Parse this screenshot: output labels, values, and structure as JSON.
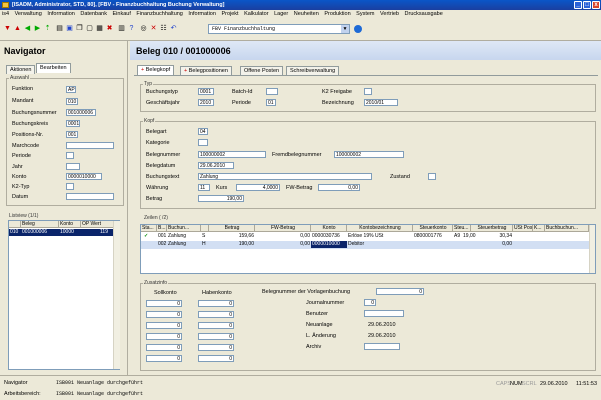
{
  "window": {
    "title": "[ISADM, Administrator, STD, 80], [FBV - Finanzbuchhaltung Buchung Verwaltung]",
    "min": "_",
    "max": "□",
    "close": "x"
  },
  "menu": [
    "is4",
    "Verwaltung",
    "Information",
    "Datenbank",
    "Einkauf",
    "Finanzbuchhaltung",
    "Information",
    "Projekt",
    "Kalkulator",
    "Lager",
    "Neuheiten",
    "Produktion",
    "System",
    "Vertrieb",
    "Drucksausgabe"
  ],
  "toolbar": {
    "icons": [
      "arrow-down-icon",
      "arrow-up-icon",
      "arrow-left-icon",
      "arrow-right-icon",
      "first-icon",
      "document-icon",
      "save-icon",
      "copy-icon",
      "new-icon",
      "attach-icon",
      "delete-icon",
      "print-icon",
      "help-icon",
      "search-icon",
      "clear-icon",
      "tree-icon",
      "undo-icon"
    ],
    "module_select": "FBV  Finanzbuchhaltung"
  },
  "navigator": {
    "title": "Navigator",
    "tabs": [
      "Aktionen",
      "Bearbeiten"
    ],
    "group_label": "Auswahl",
    "fields": [
      {
        "label": "Funktion",
        "value": "AP"
      },
      {
        "label": "Mandant",
        "value": "010"
      },
      {
        "label": "Buchungsnummer",
        "value": "001000006"
      },
      {
        "label": "Buchungskreis",
        "value": "0001"
      },
      {
        "label": "Positions-Nr.",
        "value": "001"
      },
      {
        "label": "Marchcode",
        "value": ""
      },
      {
        "label": "Periode",
        "value": ""
      },
      {
        "label": "Jahr",
        "value": ""
      },
      {
        "label": "Konto",
        "value": "0000010000"
      },
      {
        "label": "K2-Typ",
        "value": ""
      },
      {
        "label": "Datum",
        "value": ""
      }
    ],
    "list_label": "Listview (1/1)",
    "list_headers": [
      "",
      "Beleg",
      "Konto",
      "OP Wert"
    ],
    "list_rows": [
      [
        "010",
        "001000006",
        "10000",
        "119"
      ]
    ]
  },
  "main": {
    "title": "Beleg 010 / 001000006",
    "tabs": [
      "Belegkopf",
      "Belegpositionen",
      "Offene Posten",
      "Schreibverwaltung"
    ],
    "typ": {
      "label": "Typ",
      "buchungstyp_label": "Buchungstyp",
      "buchungstyp": "0001",
      "batch_label": "Batch-Id",
      "batch": "",
      "k2_label": "K2 Freigabe",
      "k2": "",
      "gj_label": "Geschäftsjahr",
      "gj": "2010",
      "periode_label": "Periode",
      "periode": "01",
      "bez_label": "Bezeichnung",
      "bez": "2010/01"
    },
    "kopf": {
      "label": "Kopf",
      "belegart_label": "Belegart",
      "belegart": "04",
      "kategorie_label": "Kategorie",
      "kategorie": "",
      "belegnummer_label": "Belegnummer",
      "belegnummer": "100000002",
      "fremd_label": "Fremdbelegnummer",
      "fremd": "100000002",
      "belegdatum_label": "Belegdatum",
      "belegdatum": "29.06.2010",
      "buchungstext_label": "Buchungstext",
      "buchungstext": "Zahlung",
      "zustand_label": "Zustand",
      "zustand": "",
      "waehrung_label": "Währung",
      "waehrung": "11",
      "kurs_label": "Kurs",
      "kurs": "4,0000",
      "fw_label": "FW-Betrag",
      "fw": "0,00",
      "betrag_label": "Betrag",
      "betrag": "190,00"
    },
    "zeilen": {
      "label": "Zeilen ( /2)",
      "headers": [
        "Sta...",
        "B...",
        "Buchun...",
        "",
        "Betrag",
        "FW-Betrag",
        "Konto",
        "Kontobezeichnung",
        "Steuerkonto",
        "Steu...",
        "Steuerbetrag",
        "USt Pos",
        "K...",
        "Buchbuchun..."
      ],
      "rows": [
        [
          "✓",
          "001",
          "Zahlung",
          "S",
          "159,66",
          "0,00",
          "0000030736",
          "Erlöse 19% USt",
          "0800001776",
          "A9",
          "19,00",
          "30,34",
          "",
          ""
        ],
        [
          "",
          "002",
          "Zahlung",
          "H",
          "190,00",
          "0,00",
          "0000010000",
          "Debitor",
          "",
          "",
          "",
          "0,00",
          "",
          ""
        ]
      ]
    },
    "zusatz": {
      "label": "Zusatzinfo",
      "sollkonto": "Sollkonto",
      "habenkonto": "Habenkonto",
      "soll_values": [
        "0",
        "0",
        "0",
        "0",
        "0",
        "0"
      ],
      "haben_values": [
        "0",
        "0",
        "0",
        "0",
        "0",
        "0"
      ],
      "vorlage_label": "Belegnummer der Vorlagenbuchung",
      "vorlage": "0",
      "journal_label": "Journalnummer",
      "journal": "0",
      "benutzer_label": "Benutzer",
      "benutzer": "",
      "neuanlage_label": "Neuanlage",
      "neuanlage": "29.06.2010",
      "aenderung_label": "L. Änderung",
      "aenderung": "29.06.2010",
      "archiv_label": "Archiv",
      "archiv": ""
    }
  },
  "status": {
    "navigator_label": "Navigator",
    "navigator_msg": "ISB001 Neuanlage durchgeführt",
    "arbeit_label": "Arbeitsbereich:",
    "arbeit_msg": "ISB001 Neuanlage durchgeführt",
    "caps": "CAPS",
    "num": "NUM",
    "scrl": "SCRL",
    "date": "29.06.2010",
    "time": "11:51:53"
  }
}
